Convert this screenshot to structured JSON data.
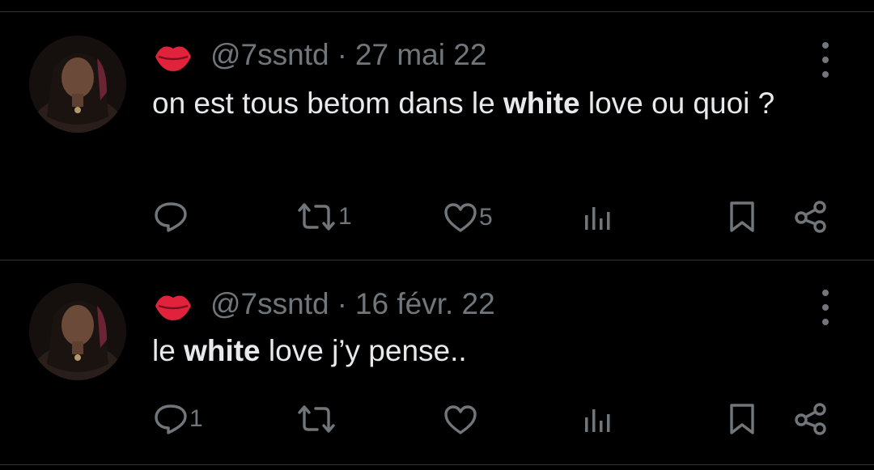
{
  "tweets": [
    {
      "handle": "@7ssntd",
      "separator": "·",
      "date": "27 mai 22",
      "text_before": "on est tous betom dans le ",
      "text_bold": "white",
      "text_after": " love ou quoi ?",
      "reply_count": "",
      "retweet_count": "1",
      "like_count": "5"
    },
    {
      "handle": "@7ssntd",
      "separator": "·",
      "date": "16 févr. 22",
      "text_before": "le ",
      "text_bold": "white",
      "text_after": " love j’y pense..",
      "reply_count": "1",
      "retweet_count": "",
      "like_count": ""
    }
  ],
  "icons": {
    "name_emoji": "kiss-lips-icon",
    "reply": "reply-icon",
    "retweet": "retweet-icon",
    "like": "heart-icon",
    "views": "views-icon",
    "bookmark": "bookmark-icon",
    "share": "share-icon",
    "more": "more-options-icon"
  },
  "colors": {
    "background": "#000000",
    "text": "#e7e9ea",
    "muted": "#71767b",
    "divider": "#2f3336",
    "lips": "#e0223a"
  }
}
